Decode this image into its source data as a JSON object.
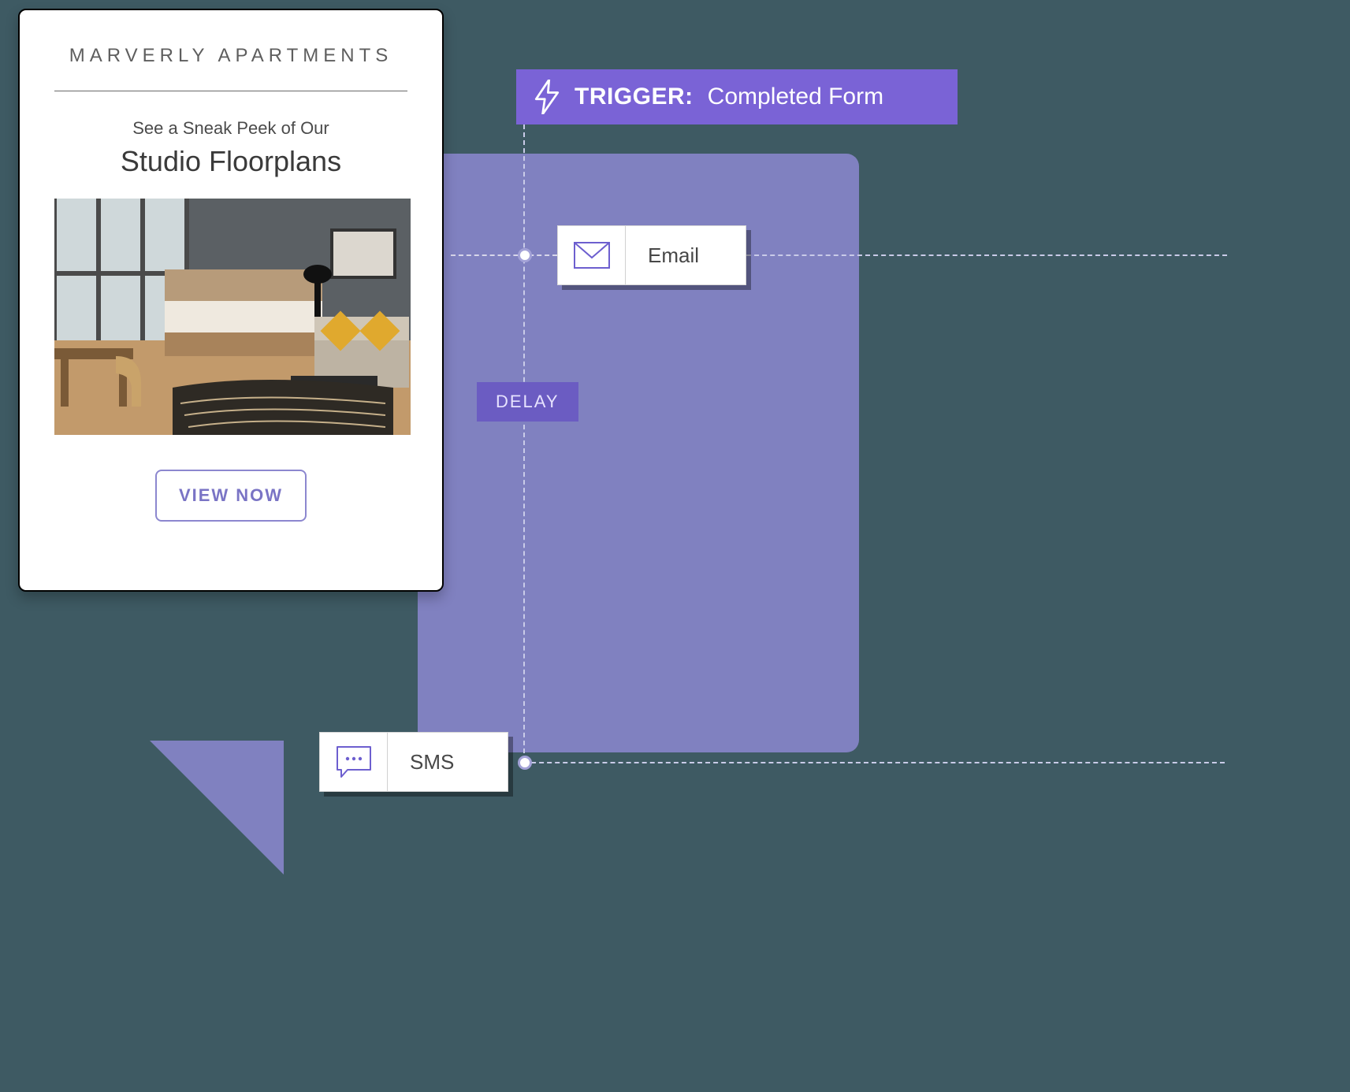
{
  "trigger": {
    "icon": "lightning-bolt-icon",
    "label": "TRIGGER:",
    "value": "Completed Form"
  },
  "email_preview": {
    "brand": "MARVERLY APARTMENTS",
    "pre_headline": "See a Sneak Peek of Our",
    "headline": "Studio Floorplans",
    "cta_label": "VIEW NOW"
  },
  "flow": {
    "email_node_label": "Email",
    "sms_node_label": "SMS",
    "delay_label": "DELAY"
  },
  "colors": {
    "accent": "#7a63d6",
    "panel": "#8081c0",
    "icon_purple": "#6d5fcf"
  }
}
